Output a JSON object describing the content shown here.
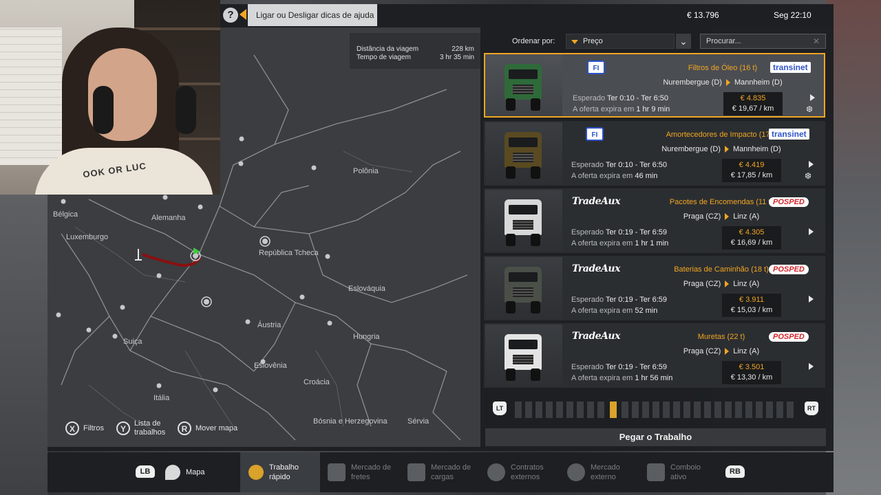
{
  "topbar": {
    "help_icon": "question-icon",
    "help_tip": "Ligar ou Desligar dicas de ajuda",
    "money": "€ 13.796",
    "clock": "Seg 22:10"
  },
  "trip": {
    "distance_label": "Distância da viagem",
    "distance_value": "228 km",
    "time_label": "Tempo de viagem",
    "time_value": "3 hr 35 min"
  },
  "map": {
    "labels": {
      "belgica": "Bélgica",
      "luxemburgo": "Luxemburgo",
      "alemanha": "Alemanha",
      "polonia": "Polônia",
      "tcheca": "República Tcheca",
      "eslovaquia": "Eslováquia",
      "austria": "Áustria",
      "hungria": "Hungria",
      "suica": "Suiça",
      "eslovenia": "Eslovênia",
      "croacia": "Croácia",
      "italia": "Itália",
      "bosnia": "Bósnia e Herzegovina",
      "servia": "Sérvia"
    },
    "controls": {
      "filtros_key": "X",
      "filtros": "Filtros",
      "lista_key": "Y",
      "lista_1": "Lista de",
      "lista_2": "trabalhos",
      "mover_key": "R",
      "mover": "Mover mapa"
    }
  },
  "list": {
    "sort_label": "Ordenar por:",
    "sort_value": "Preço",
    "search_placeholder": "Procurar...",
    "jobs": [
      {
        "cargo": "Filtros de Óleo (16 t)",
        "from": "Nurembergue (D)",
        "to": "Mannheim (D)",
        "exp_label": "Esperado",
        "exp": "Ter 0:10 - Ter 6:50",
        "exp2_label": "A oferta expira em",
        "exp2": "1 hr 9 min",
        "price": "€ 4.835",
        "perkm": "€ 19,67 / km",
        "src": "FI",
        "dst": "transinet",
        "truck_color": "#2f6a3a"
      },
      {
        "cargo": "Amortecedores de Impacto (17 t)",
        "from": "Nurembergue (D)",
        "to": "Mannheim (D)",
        "exp_label": "Esperado",
        "exp": "Ter 0:10 - Ter 6:50",
        "exp2_label": "A oferta expira em",
        "exp2": "46 min",
        "price": "€ 4.419",
        "perkm": "€ 17,85 / km",
        "src": "FI",
        "dst": "transinet",
        "truck_color": "#5a4a22"
      },
      {
        "cargo": "Pacotes de Encomendas (11 t)",
        "from": "Praga (CZ)",
        "to": "Linz (A)",
        "exp_label": "Esperado",
        "exp": "Ter 0:19 - Ter 6:59",
        "exp2_label": "A oferta expira em",
        "exp2": "1 hr 1 min",
        "price": "€ 4.305",
        "perkm": "€ 16,69 / km",
        "src": "TradeAux",
        "dst": "POSPED",
        "truck_color": "#d8d8d8"
      },
      {
        "cargo": "Baterias de Caminhão (18 t)",
        "from": "Praga (CZ)",
        "to": "Linz (A)",
        "exp_label": "Esperado",
        "exp": "Ter 0:19 - Ter 6:59",
        "exp2_label": "A oferta expira em",
        "exp2": "52 min",
        "price": "€ 3.911",
        "perkm": "€ 15,03 / km",
        "src": "TradeAux",
        "dst": "POSPED",
        "truck_color": "#4a5048"
      },
      {
        "cargo": "Muretas (22 t)",
        "from": "Praga (CZ)",
        "to": "Linz (A)",
        "exp_label": "Esperado",
        "exp": "Ter 0:19 - Ter 6:59",
        "exp2_label": "A oferta expira em",
        "exp2": "1 hr 56 min",
        "price": "€ 3.501",
        "perkm": "€ 13,30 / km",
        "src": "TradeAux",
        "dst": "POSPED",
        "truck_color": "#e4e4e4"
      }
    ],
    "pager_lt": "LT",
    "pager_rt": "RT",
    "take_button": "Pegar o Trabalho"
  },
  "bottom": {
    "lb": "LB",
    "rb": "RB",
    "tabs": {
      "mapa": "Mapa",
      "trabalho_1": "Trabalho",
      "trabalho_2": "rápido",
      "fretes_1": "Mercado de",
      "fretes_2": "fretes",
      "cargas_1": "Mercado de",
      "cargas_2": "cargas",
      "contratos_1": "Contratos",
      "contratos_2": "externos",
      "externo_1": "Mercado",
      "externo_2": "externo",
      "comboio_1": "Comboio",
      "comboio_2": "ativo"
    }
  },
  "webcam": {
    "shirt_text": "OOK OR LUC"
  },
  "colors": {
    "accent": "#f2a623",
    "panel": "#1d1f22"
  }
}
